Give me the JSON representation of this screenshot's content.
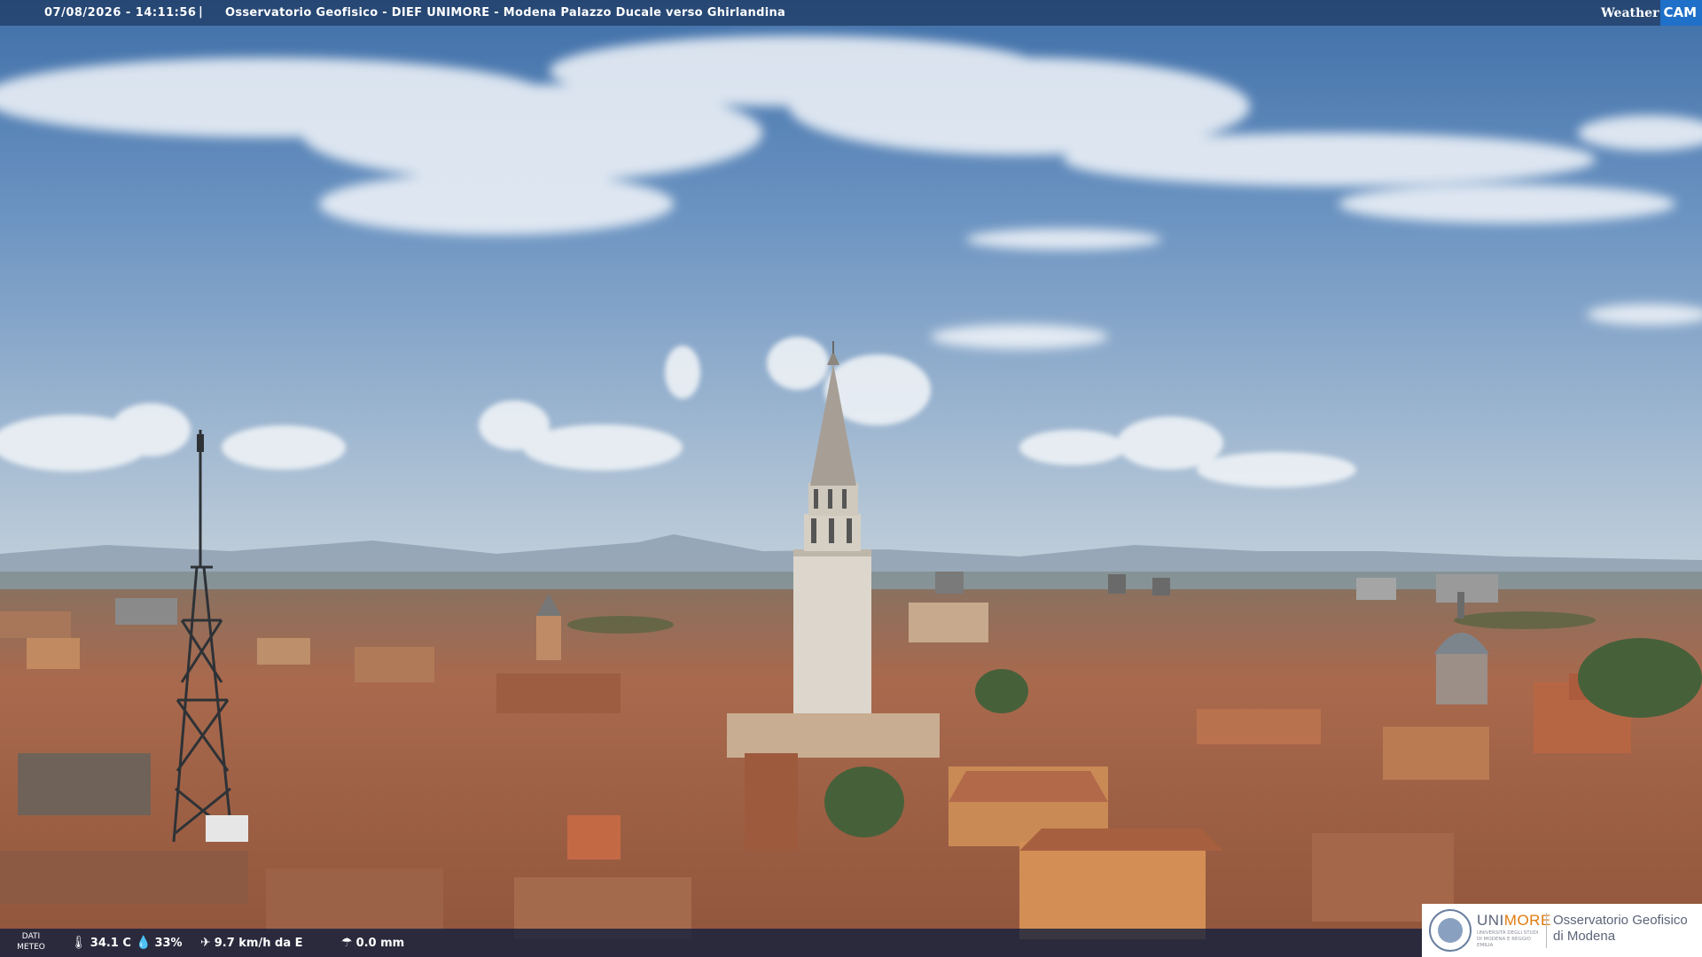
{
  "header": {
    "timestamp": "07/08/2026 - 14:11:56",
    "separator": "|",
    "title": "Osservatorio Geofisico - DIEF UNIMORE - Modena Palazzo Ducale verso Ghirlandina",
    "brand_weather": "Weather",
    "brand_cam": "CAM"
  },
  "weather": {
    "label_line1": "DATI",
    "label_line2": "METEO",
    "temperature": "34.1 C",
    "humidity": "33%",
    "wind": "9.7 km/h da E",
    "rain": "0.0 mm"
  },
  "logo": {
    "uni_part1": "UNI",
    "uni_part2": "MORE",
    "uni_sub": "UNIVERSITÀ DEGLI STUDI DI MODENA E REGGIO EMILIA",
    "observatory_line1": "Osservatorio Geofisico",
    "observatory_line2": "di Modena"
  },
  "colors": {
    "sky_top": "#3f6fa8",
    "sky_mid": "#86a9cf",
    "haze": "#c6d3dd",
    "roof": "#a8674a",
    "tower": "#d9d2c8",
    "brand_orange": "#e07a10",
    "cam_blue": "#1f70c8"
  },
  "icons": [
    "thermometer-icon",
    "humidity-icon",
    "wind-icon",
    "rain-icon",
    "unimore-seal-icon"
  ]
}
